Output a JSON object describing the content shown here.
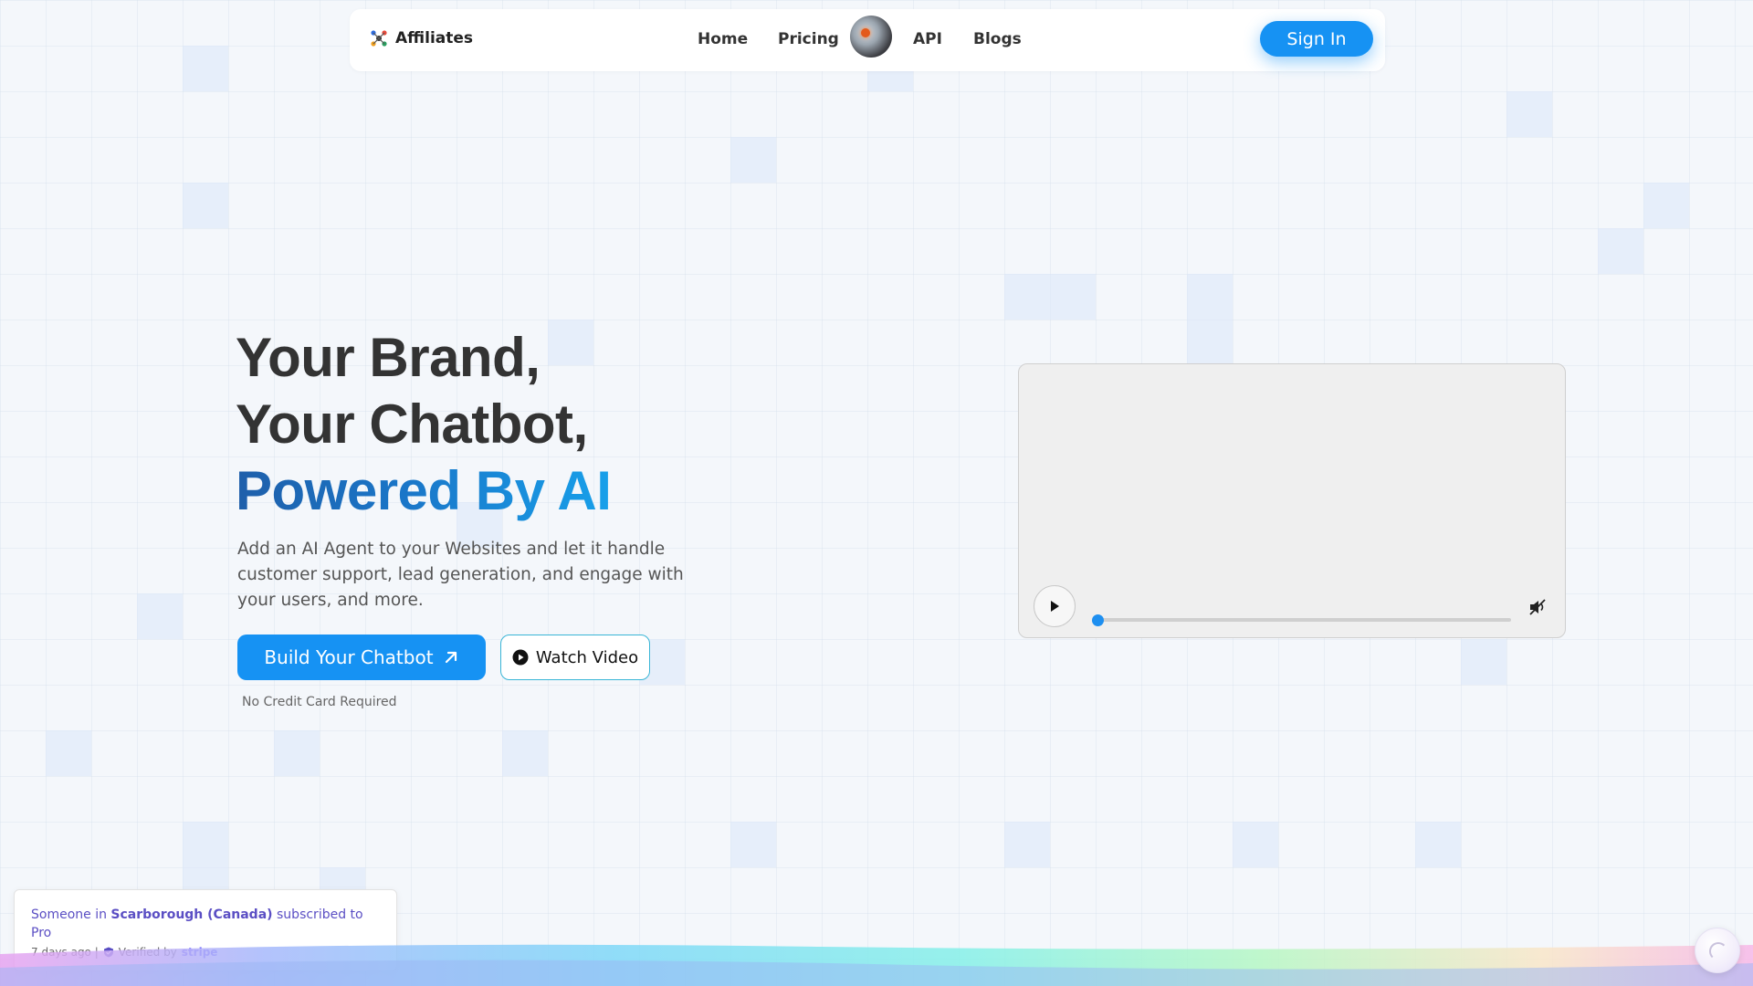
{
  "nav": {
    "brand_label": "Affiliates",
    "links": [
      "Home",
      "Pricing",
      "API",
      "Blogs"
    ],
    "signin_label": "Sign In"
  },
  "hero": {
    "title_line1": "Your Brand,",
    "title_line2": "Your Chatbot,",
    "title_line3": "Powered By AI",
    "description": "Add an AI Agent to your Websites and let it handle customer support, lead generation, and engage with your users, and more.",
    "build_label": "Build Your Chatbot",
    "watch_label": "Watch Video",
    "no_cc": "No Credit Card Required"
  },
  "video": {
    "progress": 0,
    "muted": true
  },
  "toast": {
    "prefix": "Someone in ",
    "location": "Scarborough (Canada)",
    "suffix": " subscribed to Pro",
    "time": "7 days ago |",
    "verified_label": "Verified by",
    "provider": "stripe"
  },
  "colors": {
    "accent": "#1692f3",
    "toast_text": "#5b4fc4",
    "stripe": "#635bff"
  },
  "icons": [
    "affiliates-logo-icon",
    "arrow-up-right-icon",
    "play-circle-icon",
    "play-icon",
    "mute-icon",
    "shield-check-icon",
    "chat-icon"
  ]
}
